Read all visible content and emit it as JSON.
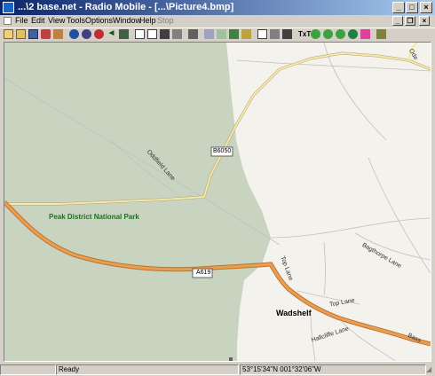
{
  "window": {
    "title": "...\\2 base.net - Radio Mobile - [...\\Picture4.bmp]",
    "controls": [
      "_",
      "□",
      "×"
    ]
  },
  "menu": {
    "items": [
      {
        "label": "File",
        "enabled": true
      },
      {
        "label": "Edit",
        "enabled": true
      },
      {
        "label": "View",
        "enabled": true
      },
      {
        "label": "Tools",
        "enabled": true
      },
      {
        "label": "Options",
        "enabled": true
      },
      {
        "label": "Window",
        "enabled": true
      },
      {
        "label": "Help",
        "enabled": true
      },
      {
        "label": "Stop",
        "enabled": false
      }
    ]
  },
  "map": {
    "colors": {
      "park": "#c8d4c0",
      "land": "#f4f2ec",
      "major_road": "#e8a050",
      "minor_road": "#f6e8a8",
      "track": "#c0c0c0"
    },
    "labels": {
      "park": "Peak District National Park",
      "road_b6050": "B6050",
      "road_a619": "A619",
      "oddfield_lane": "Oddfield Lane",
      "top_lane_vertical": "Top Lane",
      "top_lane": "Top Lane",
      "wadshelf": "Wadshelf",
      "bagthorpe_lane": "Bagthorpe Lane",
      "hallcliffe_lane": "Hallcliffe Lane",
      "bass": "Bass",
      "ode": "Ode"
    }
  },
  "status": {
    "text": "Ready",
    "coords": "53°15'34\"N 001°32'06\"W"
  }
}
